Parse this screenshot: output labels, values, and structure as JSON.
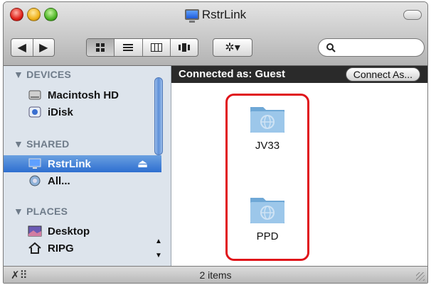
{
  "window": {
    "title": "RstrLink"
  },
  "toolbar": {
    "back_glyph": "◀",
    "forward_glyph": "▶",
    "view_icons": [
      "icon-view-icon",
      "list-view-icon",
      "column-view-icon",
      "coverflow-view-icon"
    ],
    "action_glyph": "✲▾"
  },
  "sidebar": {
    "sections": [
      {
        "label": "▼ DEVICES",
        "items": [
          {
            "label": "Macintosh HD"
          },
          {
            "label": "iDisk"
          }
        ]
      },
      {
        "label": "▼ SHARED",
        "items": [
          {
            "label": "RstrLink",
            "selected": true
          },
          {
            "label": "All..."
          }
        ]
      },
      {
        "label": "▼ PLACES",
        "items": [
          {
            "label": "Desktop"
          },
          {
            "label": "RIPG"
          }
        ]
      }
    ],
    "eject_glyph": "⏏"
  },
  "connection": {
    "status": "Connected as: Guest",
    "button_label": "Connect As..."
  },
  "main": {
    "folders": [
      {
        "name": "JV33"
      },
      {
        "name": "PPD"
      }
    ]
  },
  "status": {
    "text": "2 items"
  },
  "colors": {
    "highlight": "#e0141a",
    "selection": "#3a78d4",
    "sidebar_bg": "#dde4ec"
  }
}
